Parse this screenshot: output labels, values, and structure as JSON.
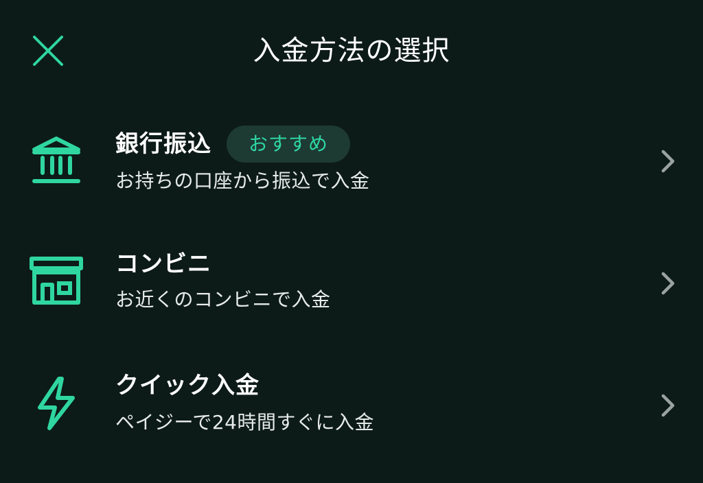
{
  "header": {
    "title": "入金方法の選択",
    "close_icon": "close-icon"
  },
  "colors": {
    "background": "#0d1b18",
    "accent": "#2fd6a0",
    "badge_background": "#1d3a33",
    "chevron": "#9aa3a0"
  },
  "methods": [
    {
      "title": "銀行振込",
      "badge": "おすすめ",
      "subtitle": "お持ちの口座から振込で入金",
      "icon": "bank-icon"
    },
    {
      "title": "コンビニ",
      "subtitle": "お近くのコンビニで入金",
      "icon": "store-icon"
    },
    {
      "title": "クイック入金",
      "subtitle": "ペイジーで24時間すぐに入金",
      "icon": "lightning-icon"
    }
  ]
}
